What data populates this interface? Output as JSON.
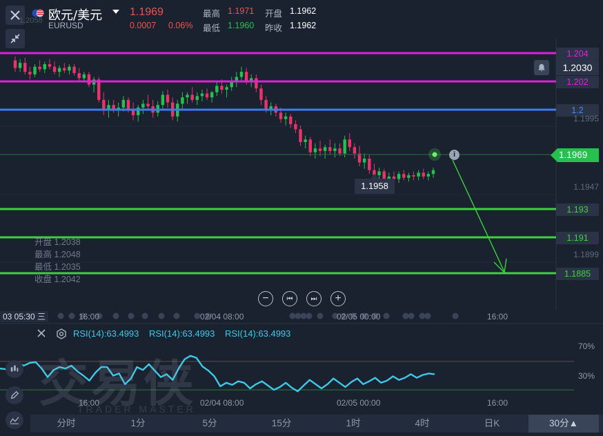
{
  "header": {
    "title": "欧元/美元",
    "symbol": "EURUSD",
    "price": "1.1969",
    "change": "0.0007",
    "change_pct": "0.06%",
    "high_label": "最高",
    "high": "1.1971",
    "low_label": "最低",
    "low": "1.1960",
    "open_label": "开盘",
    "open": "1.1962",
    "prev_close_label": "昨收",
    "prev_close": "1.1962",
    "flag_icon": "us-eu-flag-icon",
    "dropdown_icon": "caret-down-icon"
  },
  "colors": {
    "magenta": "#e020e0",
    "blue": "#3f7cf0",
    "green_line": "#3cd23c",
    "up": "#26c04e",
    "down": "#e8336b",
    "rsi": "#3fc8e8"
  },
  "horizontal_lines": [
    {
      "label": "1.204",
      "color": "#e020e0",
      "label_color": "#e020e0"
    },
    {
      "label": "1.202",
      "color": "#e020e0",
      "label_color": "#e020e0"
    },
    {
      "label": "1.2",
      "color": "#3f7cf0",
      "label_color": "#4a86f5"
    },
    {
      "label": "1.193",
      "color": "#3cd23c",
      "label_color": "#3cd23c"
    },
    {
      "label": "1.191",
      "color": "#3cd23c",
      "label_color": "#3cd23c"
    },
    {
      "label": "1.1885",
      "color": "#3cd23c",
      "label_color": "#3cd23c"
    }
  ],
  "price_axis": {
    "alert_price": "1.2030",
    "current_price": "1.1969",
    "ticks": [
      "1.1995",
      "1.1947",
      "1.1899"
    ],
    "top_faded_tick": "1.2058"
  },
  "low_tooltip": "1.1958",
  "ohlc_legend": {
    "open": "开盘 1.2038",
    "high": "最高 1.2048",
    "low": "最低 1.2035",
    "close": "收盘 1.2042"
  },
  "time_axis": {
    "crosshair_time": "03 05:30 三",
    "labels": [
      "16:00",
      "02/04 08:00",
      "02/05 00:00",
      "16:00"
    ]
  },
  "rsi": {
    "labels": [
      "RSI(14):63.4993",
      "RSI(14):63.4993",
      "RSI(14):63.4993"
    ],
    "levels": [
      "70%",
      "30%"
    ],
    "values": [
      60,
      59,
      66,
      68,
      64,
      68,
      69,
      60,
      48,
      58,
      62,
      60,
      64,
      56,
      50,
      43,
      54,
      62,
      62,
      50,
      53,
      38,
      46,
      62,
      58,
      66,
      57,
      48,
      52,
      44,
      60,
      73,
      78,
      75,
      63,
      57,
      49,
      35,
      40,
      37,
      42,
      40,
      32,
      38,
      42,
      36,
      30,
      34,
      40,
      33,
      28,
      36,
      44,
      38,
      32,
      38,
      46,
      40,
      34,
      41,
      46,
      38,
      42,
      47,
      40,
      43,
      49,
      44,
      47,
      52,
      47,
      51,
      53,
      52
    ]
  },
  "watermark": {
    "main": "交易侠",
    "sub": "TRADER MASTER"
  },
  "timeframes": {
    "items": [
      "分时",
      "1分",
      "5分",
      "15分",
      "1时",
      "4时",
      "日K",
      "30分▲"
    ],
    "active": "30分▲"
  },
  "controls": {
    "zoom_out": "−",
    "prev": "⏮",
    "next": "⏭",
    "zoom_in": "+"
  },
  "chart_data": {
    "type": "candlestick",
    "symbol": "EURUSD",
    "interval": "30分",
    "ylim": [
      1.1878,
      1.2072
    ],
    "x_labels": [
      "16:00",
      "02/04 08:00",
      "02/05 00:00",
      "16:00"
    ],
    "candles": [
      [
        1.2055,
        1.2058,
        1.2046,
        1.2049
      ],
      [
        1.2049,
        1.2056,
        1.2046,
        1.2053
      ],
      [
        1.2053,
        1.2057,
        1.2044,
        1.2046
      ],
      [
        1.2046,
        1.205,
        1.204,
        1.2044
      ],
      [
        1.2044,
        1.2052,
        1.2042,
        1.205
      ],
      [
        1.205,
        1.2055,
        1.2046,
        1.2048
      ],
      [
        1.2048,
        1.2054,
        1.2045,
        1.2052
      ],
      [
        1.2052,
        1.2056,
        1.2048,
        1.205
      ],
      [
        1.205,
        1.2054,
        1.2044,
        1.2046
      ],
      [
        1.2046,
        1.2051,
        1.2042,
        1.2049
      ],
      [
        1.2049,
        1.2053,
        1.2045,
        1.2047
      ],
      [
        1.2047,
        1.2052,
        1.2044,
        1.205
      ],
      [
        1.205,
        1.2052,
        1.2043,
        1.2045
      ],
      [
        1.2045,
        1.2049,
        1.2038,
        1.2041
      ],
      [
        1.2041,
        1.2046,
        1.2038,
        1.2044
      ],
      [
        1.2044,
        1.2046,
        1.2034,
        1.2036
      ],
      [
        1.2036,
        1.2042,
        1.203,
        1.204
      ],
      [
        1.204,
        1.2042,
        1.2022,
        1.2024
      ],
      [
        1.2024,
        1.203,
        1.2012,
        1.2016
      ],
      [
        1.2016,
        1.2024,
        1.201,
        1.202
      ],
      [
        1.202,
        1.2024,
        1.2014,
        1.2017
      ],
      [
        1.2017,
        1.2022,
        1.2011,
        1.2018
      ],
      [
        1.2018,
        1.2027,
        1.2015,
        1.2024
      ],
      [
        1.2024,
        1.2026,
        1.2014,
        1.2016
      ],
      [
        1.2016,
        1.2022,
        1.2008,
        1.2012
      ],
      [
        1.2012,
        1.202,
        1.2007,
        1.2018
      ],
      [
        1.2018,
        1.2024,
        1.2013,
        1.2021
      ],
      [
        1.2021,
        1.2028,
        1.2016,
        1.2019
      ],
      [
        1.2019,
        1.2024,
        1.201,
        1.2014
      ],
      [
        1.2014,
        1.2023,
        1.2011,
        1.202
      ],
      [
        1.202,
        1.2031,
        1.2016,
        1.2028
      ],
      [
        1.2028,
        1.2032,
        1.2018,
        1.2022
      ],
      [
        1.2022,
        1.2026,
        1.2008,
        1.2011
      ],
      [
        1.2011,
        1.2024,
        1.2007,
        1.2021
      ],
      [
        1.2021,
        1.203,
        1.2017,
        1.2026
      ],
      [
        1.2026,
        1.203,
        1.2021,
        1.2028
      ],
      [
        1.2028,
        1.2034,
        1.2022,
        1.2024
      ],
      [
        1.2024,
        1.203,
        1.202,
        1.2027
      ],
      [
        1.2027,
        1.2032,
        1.2023,
        1.2029
      ],
      [
        1.2029,
        1.2033,
        1.2024,
        1.2026
      ],
      [
        1.2026,
        1.2031,
        1.2022,
        1.203
      ],
      [
        1.203,
        1.2038,
        1.2027,
        1.2035
      ],
      [
        1.2035,
        1.204,
        1.2029,
        1.2032
      ],
      [
        1.2032,
        1.2036,
        1.2026,
        1.2034
      ],
      [
        1.2034,
        1.2042,
        1.2031,
        1.2039
      ],
      [
        1.2039,
        1.2046,
        1.2034,
        1.2042
      ],
      [
        1.2042,
        1.205,
        1.2038,
        1.2046
      ],
      [
        1.2046,
        1.2049,
        1.2036,
        1.2039
      ],
      [
        1.2039,
        1.2044,
        1.2034,
        1.2041
      ],
      [
        1.2041,
        1.2044,
        1.203,
        1.2033
      ],
      [
        1.2033,
        1.2036,
        1.202,
        1.2024
      ],
      [
        1.2024,
        1.2027,
        1.2014,
        1.2017
      ],
      [
        1.2017,
        1.2022,
        1.2012,
        1.2019
      ],
      [
        1.2019,
        1.2021,
        1.2011,
        1.2014
      ],
      [
        1.2014,
        1.2018,
        1.2006,
        1.2009
      ],
      [
        1.2009,
        1.2014,
        1.2004,
        1.2011
      ],
      [
        1.2011,
        1.2013,
        1.2002,
        1.2005
      ],
      [
        1.2005,
        1.2008,
        1.1998,
        1.2001
      ],
      [
        1.2001,
        1.2004,
        1.1988,
        1.1991
      ],
      [
        1.1991,
        1.1996,
        1.1986,
        1.1993
      ],
      [
        1.1993,
        1.1995,
        1.198,
        1.1983
      ],
      [
        1.1983,
        1.199,
        1.1978,
        1.1986
      ],
      [
        1.1986,
        1.1992,
        1.198,
        1.1984
      ],
      [
        1.1984,
        1.1989,
        1.1978,
        1.1987
      ],
      [
        1.1987,
        1.1993,
        1.1981,
        1.1984
      ],
      [
        1.1984,
        1.199,
        1.1979,
        1.1986
      ],
      [
        1.1986,
        1.199,
        1.198,
        1.1982
      ],
      [
        1.1982,
        1.1996,
        1.1979,
        1.1993
      ],
      [
        1.1993,
        1.1998,
        1.1984,
        1.1987
      ],
      [
        1.1987,
        1.199,
        1.1978,
        1.1982
      ],
      [
        1.1982,
        1.1988,
        1.1972,
        1.1975
      ],
      [
        1.1975,
        1.1982,
        1.197,
        1.1978
      ],
      [
        1.1978,
        1.1981,
        1.1966,
        1.1969
      ],
      [
        1.1969,
        1.1974,
        1.1962,
        1.1965
      ],
      [
        1.1965,
        1.1971,
        1.196,
        1.1968
      ],
      [
        1.1968,
        1.197,
        1.1958,
        1.1961
      ],
      [
        1.1961,
        1.1967,
        1.1958,
        1.1964
      ],
      [
        1.1964,
        1.1968,
        1.196,
        1.1962
      ],
      [
        1.1962,
        1.1968,
        1.1959,
        1.1966
      ],
      [
        1.1966,
        1.1969,
        1.1961,
        1.1963
      ],
      [
        1.1963,
        1.1967,
        1.196,
        1.1965
      ],
      [
        1.1965,
        1.1968,
        1.1961,
        1.1964
      ],
      [
        1.1964,
        1.1969,
        1.1961,
        1.1967
      ],
      [
        1.1967,
        1.197,
        1.1962,
        1.1964
      ],
      [
        1.1964,
        1.1968,
        1.1961,
        1.1966
      ],
      [
        1.1966,
        1.1971,
        1.1963,
        1.1969
      ]
    ],
    "horizontal_levels": [
      1.204,
      1.202,
      1.2,
      1.193,
      1.191,
      1.1885
    ],
    "projection": {
      "from": 1.1969,
      "to": 1.1885
    }
  }
}
